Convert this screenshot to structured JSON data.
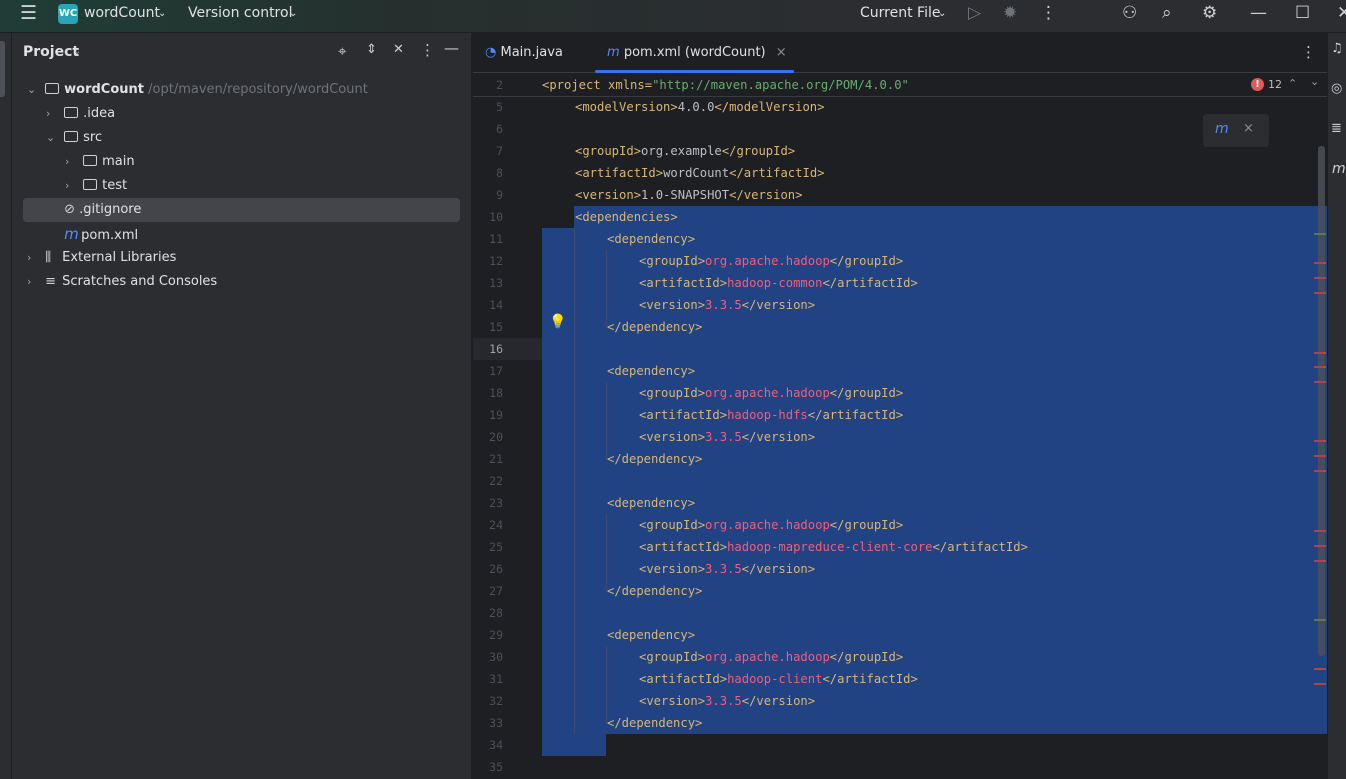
{
  "titlebar": {
    "project_badge": "WC",
    "project_name": "wordCount",
    "vcs": "Version control",
    "run_config": "Current File",
    "colors": {
      "badge": "#2aa5b8"
    }
  },
  "project_panel": {
    "title": "Project",
    "tree": [
      {
        "label": "wordCount",
        "path": "/opt/maven/repository/wordCount",
        "level": 0,
        "expanded": true,
        "icon": "module-folder-icon"
      },
      {
        "label": ".idea",
        "level": 1,
        "expanded": false,
        "icon": "folder-icon"
      },
      {
        "label": "src",
        "level": 1,
        "expanded": true,
        "icon": "folder-icon"
      },
      {
        "label": "main",
        "level": 2,
        "expanded": false,
        "icon": "folder-icon"
      },
      {
        "label": "test",
        "level": 2,
        "expanded": false,
        "icon": "folder-icon"
      },
      {
        "label": ".gitignore",
        "level": 1,
        "icon": "ignore-file-icon",
        "selected": true
      },
      {
        "label": "pom.xml",
        "level": 1,
        "icon": "maven-icon"
      },
      {
        "label": "External Libraries",
        "level": 0,
        "expanded": false,
        "icon": "library-icon"
      },
      {
        "label": "Scratches and Consoles",
        "level": 0,
        "expanded": false,
        "icon": "scratches-icon"
      }
    ]
  },
  "tabs": [
    {
      "label": "Main.java",
      "active": false
    },
    {
      "label": "pom.xml (wordCount)",
      "active": true
    }
  ],
  "editor": {
    "sticky_line": {
      "num": "2",
      "open": "<project xmlns=",
      "str": "\"http://maven.apache.org/POM/4.0.0\""
    },
    "error_count": "12",
    "lines": [
      {
        "num": "5",
        "indent": 1,
        "o": "<modelVersion>",
        "v": "4.0.0",
        "c": "</modelVersion>",
        "plainval": true
      },
      {
        "num": "6",
        "indent": 0
      },
      {
        "num": "7",
        "indent": 1,
        "o": "<groupId>",
        "v": "org.example",
        "c": "</groupId>",
        "plainval": true
      },
      {
        "num": "8",
        "indent": 1,
        "o": "<artifactId>",
        "v": "wordCount",
        "c": "</artifactId>",
        "plainval": true
      },
      {
        "num": "9",
        "indent": 1,
        "o": "<version>",
        "v": "1.0-SNAPSHOT",
        "c": "</version>",
        "plainval": true
      },
      {
        "num": "10",
        "indent": 1,
        "o": "<dependencies>"
      },
      {
        "num": "11",
        "indent": 2,
        "o": "<dependency>"
      },
      {
        "num": "12",
        "indent": 3,
        "o": "<groupId>",
        "v": "org.apache.hadoop",
        "c": "</groupId>"
      },
      {
        "num": "13",
        "indent": 3,
        "o": "<artifactId>",
        "v": "hadoop-common",
        "c": "</artifactId>"
      },
      {
        "num": "14",
        "indent": 3,
        "o": "<version>",
        "v": "3.3.5",
        "c": "</version>"
      },
      {
        "num": "15",
        "indent": 2,
        "o": "</dependency>"
      },
      {
        "num": "16",
        "indent": 0
      },
      {
        "num": "17",
        "indent": 2,
        "o": "<dependency>"
      },
      {
        "num": "18",
        "indent": 3,
        "o": "<groupId>",
        "v": "org.apache.hadoop",
        "c": "</groupId>"
      },
      {
        "num": "19",
        "indent": 3,
        "o": "<artifactId>",
        "v": "hadoop-hdfs",
        "c": "</artifactId>"
      },
      {
        "num": "20",
        "indent": 3,
        "o": "<version>",
        "v": "3.3.5",
        "c": "</version>"
      },
      {
        "num": "21",
        "indent": 2,
        "o": "</dependency>"
      },
      {
        "num": "22",
        "indent": 0
      },
      {
        "num": "23",
        "indent": 2,
        "o": "<dependency>"
      },
      {
        "num": "24",
        "indent": 3,
        "o": "<groupId>",
        "v": "org.apache.hadoop",
        "c": "</groupId>"
      },
      {
        "num": "25",
        "indent": 3,
        "o": "<artifactId>",
        "v": "hadoop-mapreduce-client-core",
        "c": "</artifactId>"
      },
      {
        "num": "26",
        "indent": 3,
        "o": "<version>",
        "v": "3.3.5",
        "c": "</version>"
      },
      {
        "num": "27",
        "indent": 2,
        "o": "</dependency>"
      },
      {
        "num": "28",
        "indent": 0
      },
      {
        "num": "29",
        "indent": 2,
        "o": "<dependency>"
      },
      {
        "num": "30",
        "indent": 3,
        "o": "<groupId>",
        "v": "org.apache.hadoop",
        "c": "</groupId>"
      },
      {
        "num": "31",
        "indent": 3,
        "o": "<artifactId>",
        "v": "hadoop-client",
        "c": "</artifactId>"
      },
      {
        "num": "32",
        "indent": 3,
        "o": "<version>",
        "v": "3.3.5",
        "c": "</version>"
      },
      {
        "num": "33",
        "indent": 2,
        "o": "</dependency>"
      },
      {
        "num": "34",
        "indent": 0
      },
      {
        "num": "35",
        "indent": 0
      }
    ],
    "colors": {
      "selection": "#214283",
      "tag": "#d5b778",
      "unresolved": "#ef5e7d",
      "string": "#6aab73"
    }
  }
}
